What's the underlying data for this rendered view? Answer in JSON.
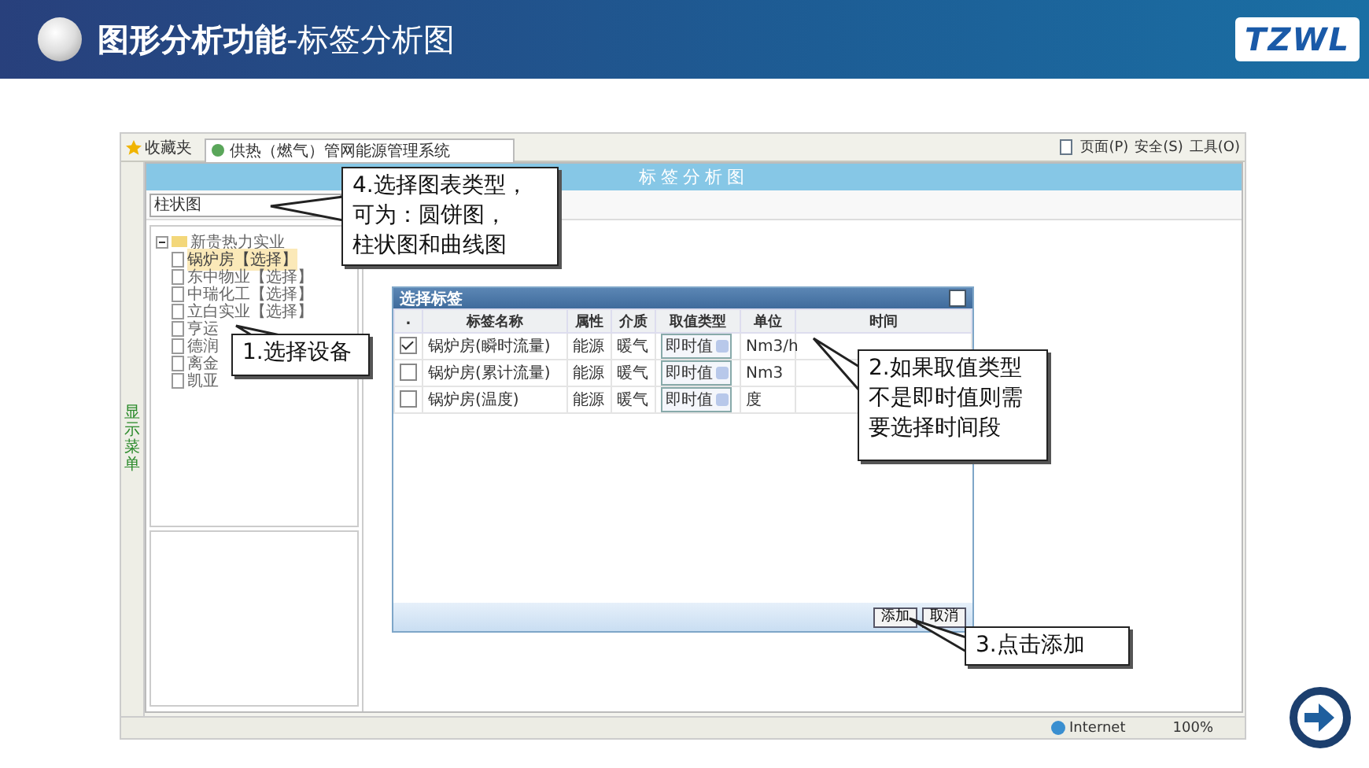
{
  "slide": {
    "title": "图形分析功能",
    "subtitle": "-标签分析图",
    "logo": "TZWL"
  },
  "browser": {
    "favorites": "收藏夹",
    "tab": "供热（燃气）管网能源管理系统",
    "toolbar": [
      "页面(P)",
      "安全(S)",
      "工具(O)"
    ],
    "status": "Internet",
    "zoom": "100%"
  },
  "app": {
    "side_menu": "显示菜单",
    "header": "标签分析图",
    "chart_type": "柱状图",
    "tree": {
      "label": "新贵热力实业",
      "expanded": true,
      "children": [
        {
          "label": "锅炉房【选择】",
          "selected": true
        },
        {
          "label": "东中物业【选择】",
          "selected": false
        },
        {
          "label": "中瑞化工【选择】",
          "selected": false
        },
        {
          "label": "立白实业【选择】",
          "selected": false
        },
        {
          "label": "亨运",
          "selected": false
        },
        {
          "label": "德润",
          "selected": false
        },
        {
          "label": "离金",
          "selected": false
        },
        {
          "label": "凯亚",
          "selected": false
        }
      ]
    }
  },
  "dialog": {
    "title": "选择标签",
    "columns": [
      ".",
      "标签名称",
      "属性",
      "介质",
      "取值类型",
      "单位",
      "时间"
    ],
    "rows": [
      {
        "checked": true,
        "name": "锅炉房(瞬时流量)",
        "attribute": "能源",
        "medium": "暖气",
        "value_type": "即时值",
        "unit": "Nm3/h"
      },
      {
        "checked": false,
        "name": "锅炉房(累计流量)",
        "attribute": "能源",
        "medium": "暖气",
        "value_type": "即时值",
        "unit": "Nm3"
      },
      {
        "checked": false,
        "name": "锅炉房(温度)",
        "attribute": "能源",
        "medium": "暖气",
        "value_type": "即时值",
        "unit": "度"
      }
    ],
    "buttons": [
      "添加",
      "取消"
    ]
  },
  "callouts": [
    {
      "lines": [
        "4.选择图表类型，",
        "可为：圆饼图，",
        "柱状图和曲线图"
      ]
    },
    {
      "lines": [
        "1.选择设备"
      ]
    },
    {
      "lines": [
        "2.如果取值类型",
        "不是即时值则需",
        "要选择时间段"
      ]
    },
    {
      "lines": [
        "3.点击添加"
      ]
    }
  ]
}
